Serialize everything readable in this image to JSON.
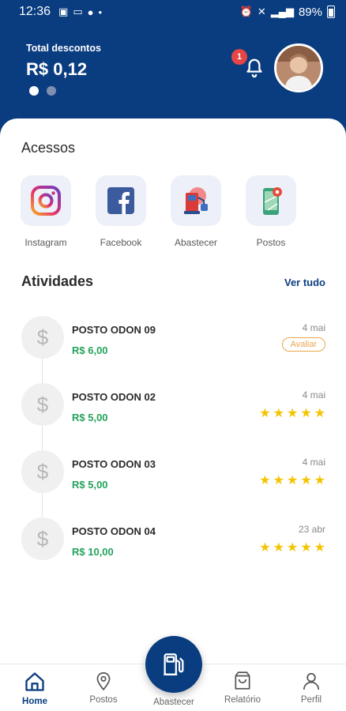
{
  "status_bar": {
    "time": "12:36",
    "battery": "89%"
  },
  "header": {
    "total_label": "Total descontos",
    "total_value": "R$ 0,12",
    "notification_count": "1"
  },
  "acessos": {
    "title": "Acessos",
    "items": [
      {
        "label": "Instagram"
      },
      {
        "label": "Facebook"
      },
      {
        "label": "Abastecer"
      },
      {
        "label": "Postos"
      }
    ]
  },
  "atividades": {
    "title": "Atividades",
    "see_all": "Ver tudo",
    "items": [
      {
        "name": "POSTO ODON 09",
        "price": "R$ 6,00",
        "date": "4 mai",
        "action": "Avaliar",
        "stars": 0
      },
      {
        "name": "POSTO ODON 02",
        "price": "R$ 5,00",
        "date": "4 mai",
        "stars": 5
      },
      {
        "name": "POSTO ODON 03",
        "price": "R$ 5,00",
        "date": "4 mai",
        "stars": 5
      },
      {
        "name": "POSTO ODON 04",
        "price": "R$ 10,00",
        "date": "23 abr",
        "stars": 5
      }
    ]
  },
  "nav": {
    "home": "Home",
    "postos": "Postos",
    "abastecer": "Abastecer",
    "relatorio": "Relatório",
    "perfil": "Perfil"
  },
  "colors": {
    "primary": "#0a3d80",
    "price": "#22a35a",
    "star": "#f4c400",
    "badge": "#e64545",
    "rate": "#e8a64a"
  }
}
